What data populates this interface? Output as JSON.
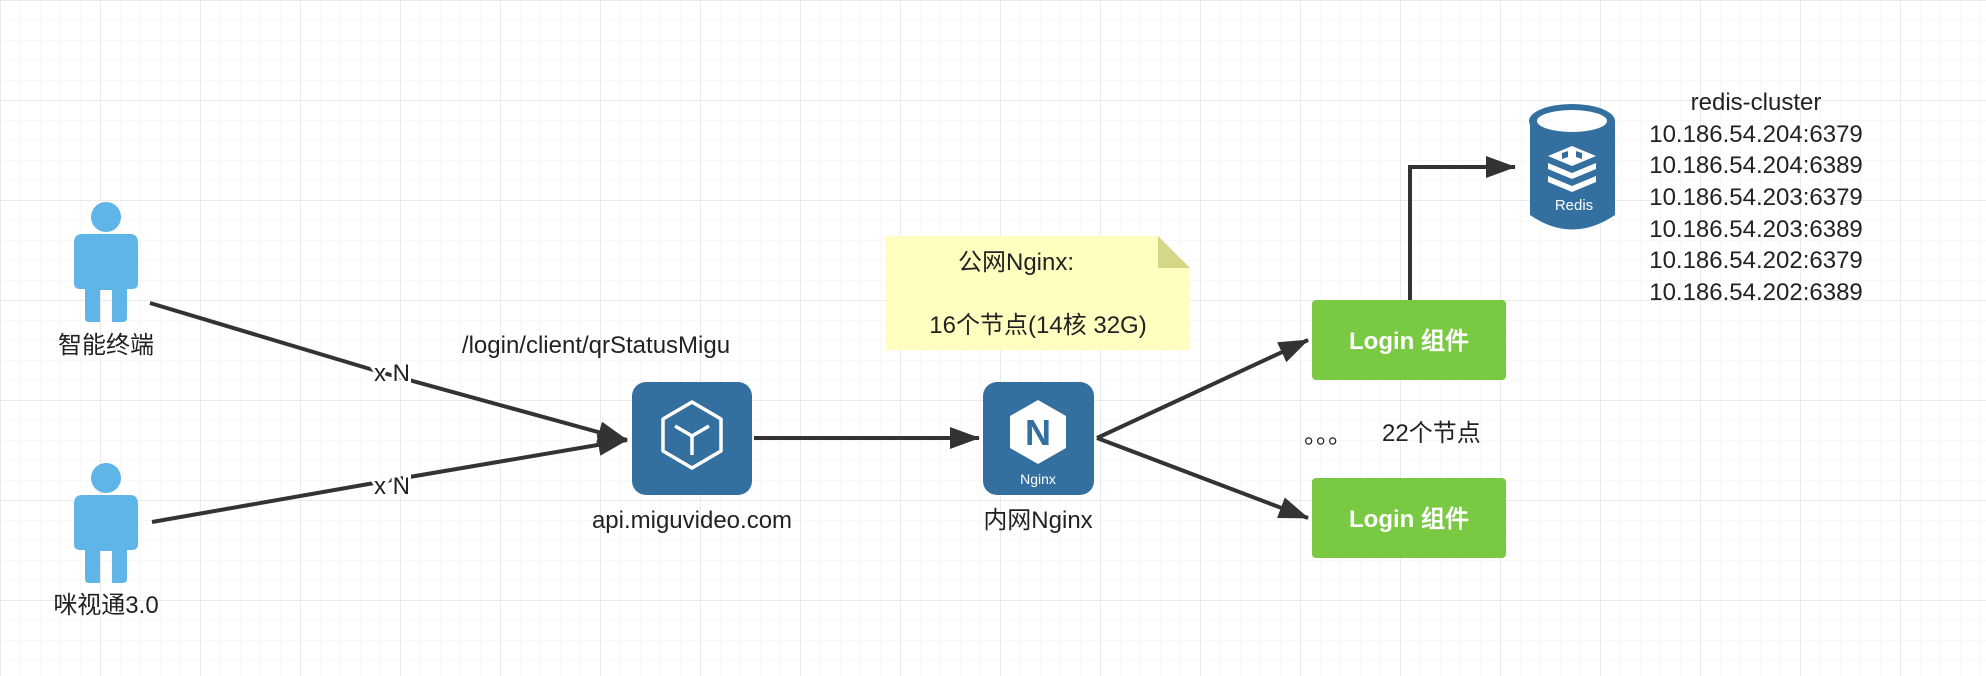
{
  "colors": {
    "grid": "#e6e6e6",
    "edge": "#333333",
    "person": "#5fb4e8",
    "service_blue": "#33709f",
    "login_green": "#7ac943",
    "note_fill": "#ffffc0",
    "note_fold": "#d6d689",
    "text": "#222222"
  },
  "users": [
    {
      "label": "智能终端",
      "icon": "person-icon"
    },
    {
      "label": "咪视通3.0",
      "icon": "person-icon"
    }
  ],
  "edges": {
    "multiplier_top": "x N",
    "multiplier_bottom": "x N",
    "path_label": "/login/client/qrStatusMigu"
  },
  "api": {
    "label": "api.miguvideo.com",
    "icon": "cube-icon"
  },
  "note": {
    "line1": "公网Nginx:",
    "line2": "16个节点(14核 32G)"
  },
  "internal_nginx": {
    "label": "内网Nginx",
    "icon_letter": "N",
    "icon_caption": "Nginx"
  },
  "login": {
    "top_label": "Login 组件",
    "bottom_label": "Login 组件",
    "dots": "。。。",
    "count": "22个节点"
  },
  "redis": {
    "icon_caption": "Redis",
    "title": "redis-cluster",
    "nodes": [
      "10.186.54.204:6379",
      "10.186.54.204:6389",
      "10.186.54.203:6379",
      "10.186.54.203:6389",
      "10.186.54.202:6379",
      "10.186.54.202:6389"
    ]
  }
}
